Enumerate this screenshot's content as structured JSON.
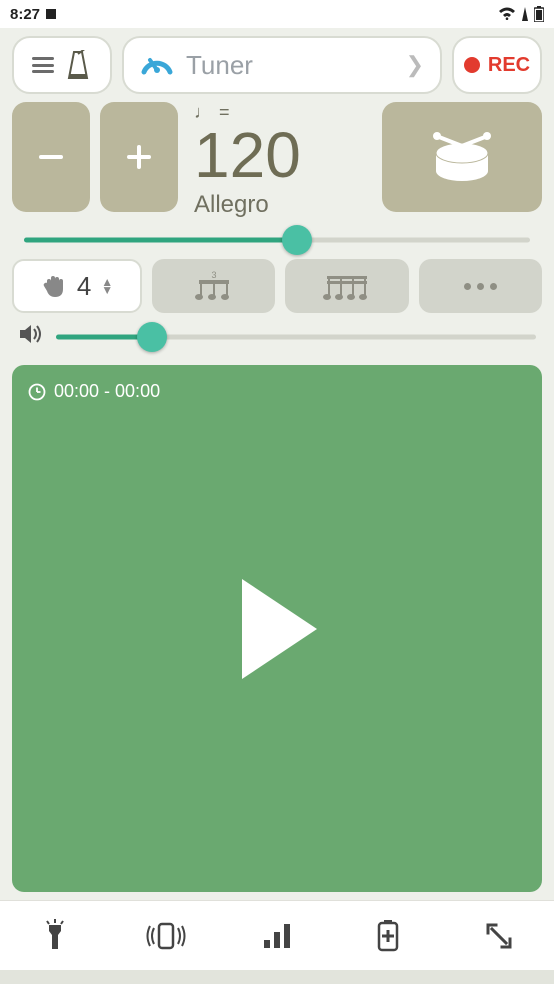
{
  "status": {
    "time": "8:27"
  },
  "topbar": {
    "tuner_label": "Tuner",
    "rec_label": "REC"
  },
  "tempo": {
    "note_equals": "♩ =",
    "bpm": "120",
    "name": "Allegro",
    "slider_percent": 54
  },
  "beats": {
    "count": "4"
  },
  "volume": {
    "slider_percent": 20
  },
  "playback": {
    "elapsed": "00:00",
    "total": "00:00",
    "timer_text": "00:00 - 00:00"
  },
  "colors": {
    "accent": "#4ac0a4",
    "play_bg": "#6aa970",
    "button_bg": "#bab79c",
    "rec": "#e23b2e"
  }
}
